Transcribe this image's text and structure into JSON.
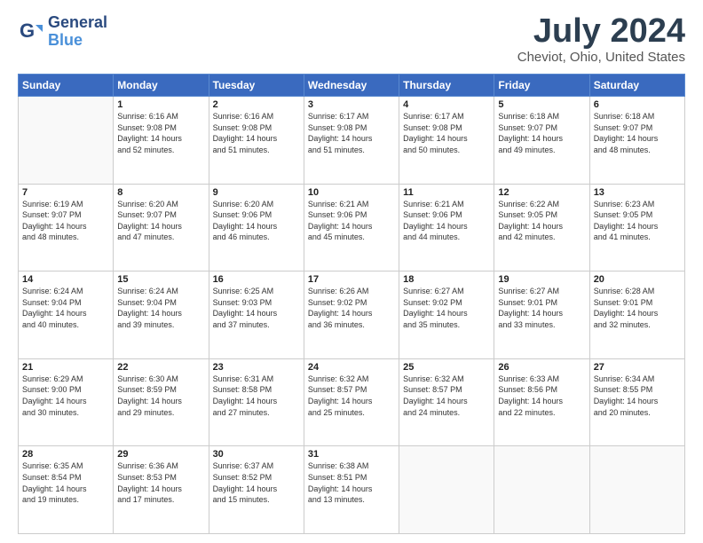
{
  "logo": {
    "line1": "General",
    "line2": "Blue"
  },
  "header": {
    "month_year": "July 2024",
    "location": "Cheviot, Ohio, United States"
  },
  "days_of_week": [
    "Sunday",
    "Monday",
    "Tuesday",
    "Wednesday",
    "Thursday",
    "Friday",
    "Saturday"
  ],
  "weeks": [
    [
      {
        "day": "",
        "content": ""
      },
      {
        "day": "1",
        "content": "Sunrise: 6:16 AM\nSunset: 9:08 PM\nDaylight: 14 hours\nand 52 minutes."
      },
      {
        "day": "2",
        "content": "Sunrise: 6:16 AM\nSunset: 9:08 PM\nDaylight: 14 hours\nand 51 minutes."
      },
      {
        "day": "3",
        "content": "Sunrise: 6:17 AM\nSunset: 9:08 PM\nDaylight: 14 hours\nand 51 minutes."
      },
      {
        "day": "4",
        "content": "Sunrise: 6:17 AM\nSunset: 9:08 PM\nDaylight: 14 hours\nand 50 minutes."
      },
      {
        "day": "5",
        "content": "Sunrise: 6:18 AM\nSunset: 9:07 PM\nDaylight: 14 hours\nand 49 minutes."
      },
      {
        "day": "6",
        "content": "Sunrise: 6:18 AM\nSunset: 9:07 PM\nDaylight: 14 hours\nand 48 minutes."
      }
    ],
    [
      {
        "day": "7",
        "content": "Sunrise: 6:19 AM\nSunset: 9:07 PM\nDaylight: 14 hours\nand 48 minutes."
      },
      {
        "day": "8",
        "content": "Sunrise: 6:20 AM\nSunset: 9:07 PM\nDaylight: 14 hours\nand 47 minutes."
      },
      {
        "day": "9",
        "content": "Sunrise: 6:20 AM\nSunset: 9:06 PM\nDaylight: 14 hours\nand 46 minutes."
      },
      {
        "day": "10",
        "content": "Sunrise: 6:21 AM\nSunset: 9:06 PM\nDaylight: 14 hours\nand 45 minutes."
      },
      {
        "day": "11",
        "content": "Sunrise: 6:21 AM\nSunset: 9:06 PM\nDaylight: 14 hours\nand 44 minutes."
      },
      {
        "day": "12",
        "content": "Sunrise: 6:22 AM\nSunset: 9:05 PM\nDaylight: 14 hours\nand 42 minutes."
      },
      {
        "day": "13",
        "content": "Sunrise: 6:23 AM\nSunset: 9:05 PM\nDaylight: 14 hours\nand 41 minutes."
      }
    ],
    [
      {
        "day": "14",
        "content": "Sunrise: 6:24 AM\nSunset: 9:04 PM\nDaylight: 14 hours\nand 40 minutes."
      },
      {
        "day": "15",
        "content": "Sunrise: 6:24 AM\nSunset: 9:04 PM\nDaylight: 14 hours\nand 39 minutes."
      },
      {
        "day": "16",
        "content": "Sunrise: 6:25 AM\nSunset: 9:03 PM\nDaylight: 14 hours\nand 37 minutes."
      },
      {
        "day": "17",
        "content": "Sunrise: 6:26 AM\nSunset: 9:02 PM\nDaylight: 14 hours\nand 36 minutes."
      },
      {
        "day": "18",
        "content": "Sunrise: 6:27 AM\nSunset: 9:02 PM\nDaylight: 14 hours\nand 35 minutes."
      },
      {
        "day": "19",
        "content": "Sunrise: 6:27 AM\nSunset: 9:01 PM\nDaylight: 14 hours\nand 33 minutes."
      },
      {
        "day": "20",
        "content": "Sunrise: 6:28 AM\nSunset: 9:01 PM\nDaylight: 14 hours\nand 32 minutes."
      }
    ],
    [
      {
        "day": "21",
        "content": "Sunrise: 6:29 AM\nSunset: 9:00 PM\nDaylight: 14 hours\nand 30 minutes."
      },
      {
        "day": "22",
        "content": "Sunrise: 6:30 AM\nSunset: 8:59 PM\nDaylight: 14 hours\nand 29 minutes."
      },
      {
        "day": "23",
        "content": "Sunrise: 6:31 AM\nSunset: 8:58 PM\nDaylight: 14 hours\nand 27 minutes."
      },
      {
        "day": "24",
        "content": "Sunrise: 6:32 AM\nSunset: 8:57 PM\nDaylight: 14 hours\nand 25 minutes."
      },
      {
        "day": "25",
        "content": "Sunrise: 6:32 AM\nSunset: 8:57 PM\nDaylight: 14 hours\nand 24 minutes."
      },
      {
        "day": "26",
        "content": "Sunrise: 6:33 AM\nSunset: 8:56 PM\nDaylight: 14 hours\nand 22 minutes."
      },
      {
        "day": "27",
        "content": "Sunrise: 6:34 AM\nSunset: 8:55 PM\nDaylight: 14 hours\nand 20 minutes."
      }
    ],
    [
      {
        "day": "28",
        "content": "Sunrise: 6:35 AM\nSunset: 8:54 PM\nDaylight: 14 hours\nand 19 minutes."
      },
      {
        "day": "29",
        "content": "Sunrise: 6:36 AM\nSunset: 8:53 PM\nDaylight: 14 hours\nand 17 minutes."
      },
      {
        "day": "30",
        "content": "Sunrise: 6:37 AM\nSunset: 8:52 PM\nDaylight: 14 hours\nand 15 minutes."
      },
      {
        "day": "31",
        "content": "Sunrise: 6:38 AM\nSunset: 8:51 PM\nDaylight: 14 hours\nand 13 minutes."
      },
      {
        "day": "",
        "content": ""
      },
      {
        "day": "",
        "content": ""
      },
      {
        "day": "",
        "content": ""
      }
    ]
  ]
}
